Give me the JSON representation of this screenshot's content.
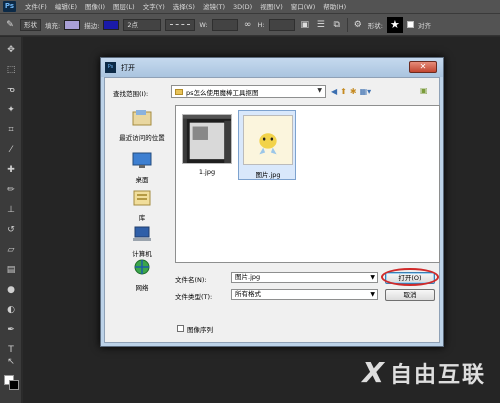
{
  "app": {
    "logo": "Ps"
  },
  "menu": [
    "文件(F)",
    "编辑(E)",
    "图像(I)",
    "图层(L)",
    "文字(Y)",
    "选择(S)",
    "滤镜(T)",
    "3D(D)",
    "视图(V)",
    "窗口(W)",
    "帮助(H)"
  ],
  "options": {
    "mode": "形状",
    "fill_label": "填充:",
    "stroke_label": "描边:",
    "stroke_size": "2点",
    "w_label": "W:",
    "h_label": "H:",
    "shape_label": "形状:",
    "align_label": "对齐",
    "fill_color": "#a9a0d6",
    "stroke_color": "#1a1aa8"
  },
  "dialog": {
    "title": "打开",
    "look_in_label": "查找范围(I):",
    "look_in_value": "ps怎么使用魔棒工具抠图",
    "places": [
      "最近访问的位置",
      "桌面",
      "库",
      "计算机",
      "网络"
    ],
    "files": [
      {
        "name": "1.jpg"
      },
      {
        "name": "图片.jpg"
      }
    ],
    "filename_label": "文件名(N):",
    "filename_value": "图片.jpg",
    "filetype_label": "文件类型(T):",
    "filetype_value": "所有格式",
    "open_button": "打开(O)",
    "cancel_button": "取消",
    "image_sequence_label": "图像序列"
  },
  "watermark": {
    "logo": "X",
    "text": "自由互联"
  }
}
